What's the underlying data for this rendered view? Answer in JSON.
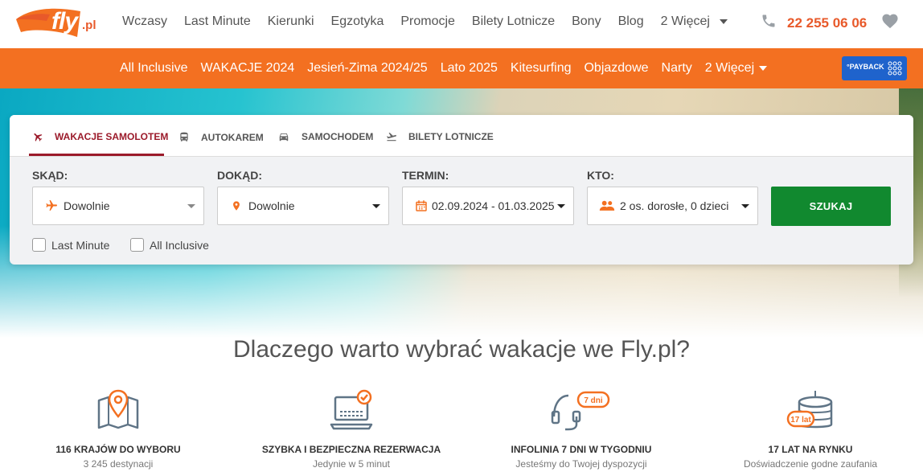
{
  "logo": {
    "text": "fly",
    "suffix": ".pl"
  },
  "topnav": {
    "items": [
      "Wczasy",
      "Last Minute",
      "Kierunki",
      "Egzotyka",
      "Promocje",
      "Bilety Lotnicze",
      "Bony",
      "Blog"
    ],
    "more_label": "2 Więcej"
  },
  "contact": {
    "phone": "22 255 06 06"
  },
  "subnav": {
    "items": [
      "All Inclusive",
      "WAKACJE 2024",
      "Jesień-Zima 2024/25",
      "Lato 2025",
      "Kitesurfing",
      "Objazdowe",
      "Narty"
    ],
    "more_label": "2 Więcej"
  },
  "payback": {
    "label": "°PAYBACK"
  },
  "search": {
    "tabs": [
      {
        "label": "WAKACJE SAMOLOTEM",
        "icon": "plane-icon"
      },
      {
        "label": "AUTOKAREM",
        "icon": "bus-icon"
      },
      {
        "label": "SAMOCHODEM",
        "icon": "car-icon"
      },
      {
        "label": "BILETY LOTNICZE",
        "icon": "takeoff-icon"
      }
    ],
    "from": {
      "label": "SKĄD:",
      "value": "Dowolnie"
    },
    "to": {
      "label": "DOKĄD:",
      "value": "Dowolnie"
    },
    "date": {
      "label": "TERMIN:",
      "value": "02.09.2024 - 01.03.2025"
    },
    "who": {
      "label": "KTO:",
      "value": "2 os. dorosłe, 0 dzieci"
    },
    "submit_label": "SZUKAJ",
    "checkboxes": [
      "Last Minute",
      "All Inclusive"
    ]
  },
  "why": {
    "title": "Dlaczego warto wybrać wakacje we Fly.pl?",
    "features": [
      {
        "title": "116 KRAJÓW DO WYBORU",
        "subtitle": "3 245 destynacji",
        "icon": "map-pin-icon"
      },
      {
        "title": "SZYBKA I BEZPIECZNA REZERWACJA",
        "subtitle": "Jedynie w 5 minut",
        "icon": "laptop-check-icon"
      },
      {
        "title": "INFOLINIA 7 DNI W TYGODNIU",
        "subtitle": "Jesteśmy do Twojej dyspozycji",
        "icon": "headset-icon",
        "badge": "7 dni"
      },
      {
        "title": "17 LAT NA RYNKU",
        "subtitle": "Doświadczenie godne zaufania",
        "icon": "cake-icon",
        "badge": "17 lat"
      }
    ]
  },
  "colors": {
    "brand": "#f37021",
    "accent": "#9b1a2a",
    "cta": "#11892f",
    "phone": "#e8592a"
  }
}
